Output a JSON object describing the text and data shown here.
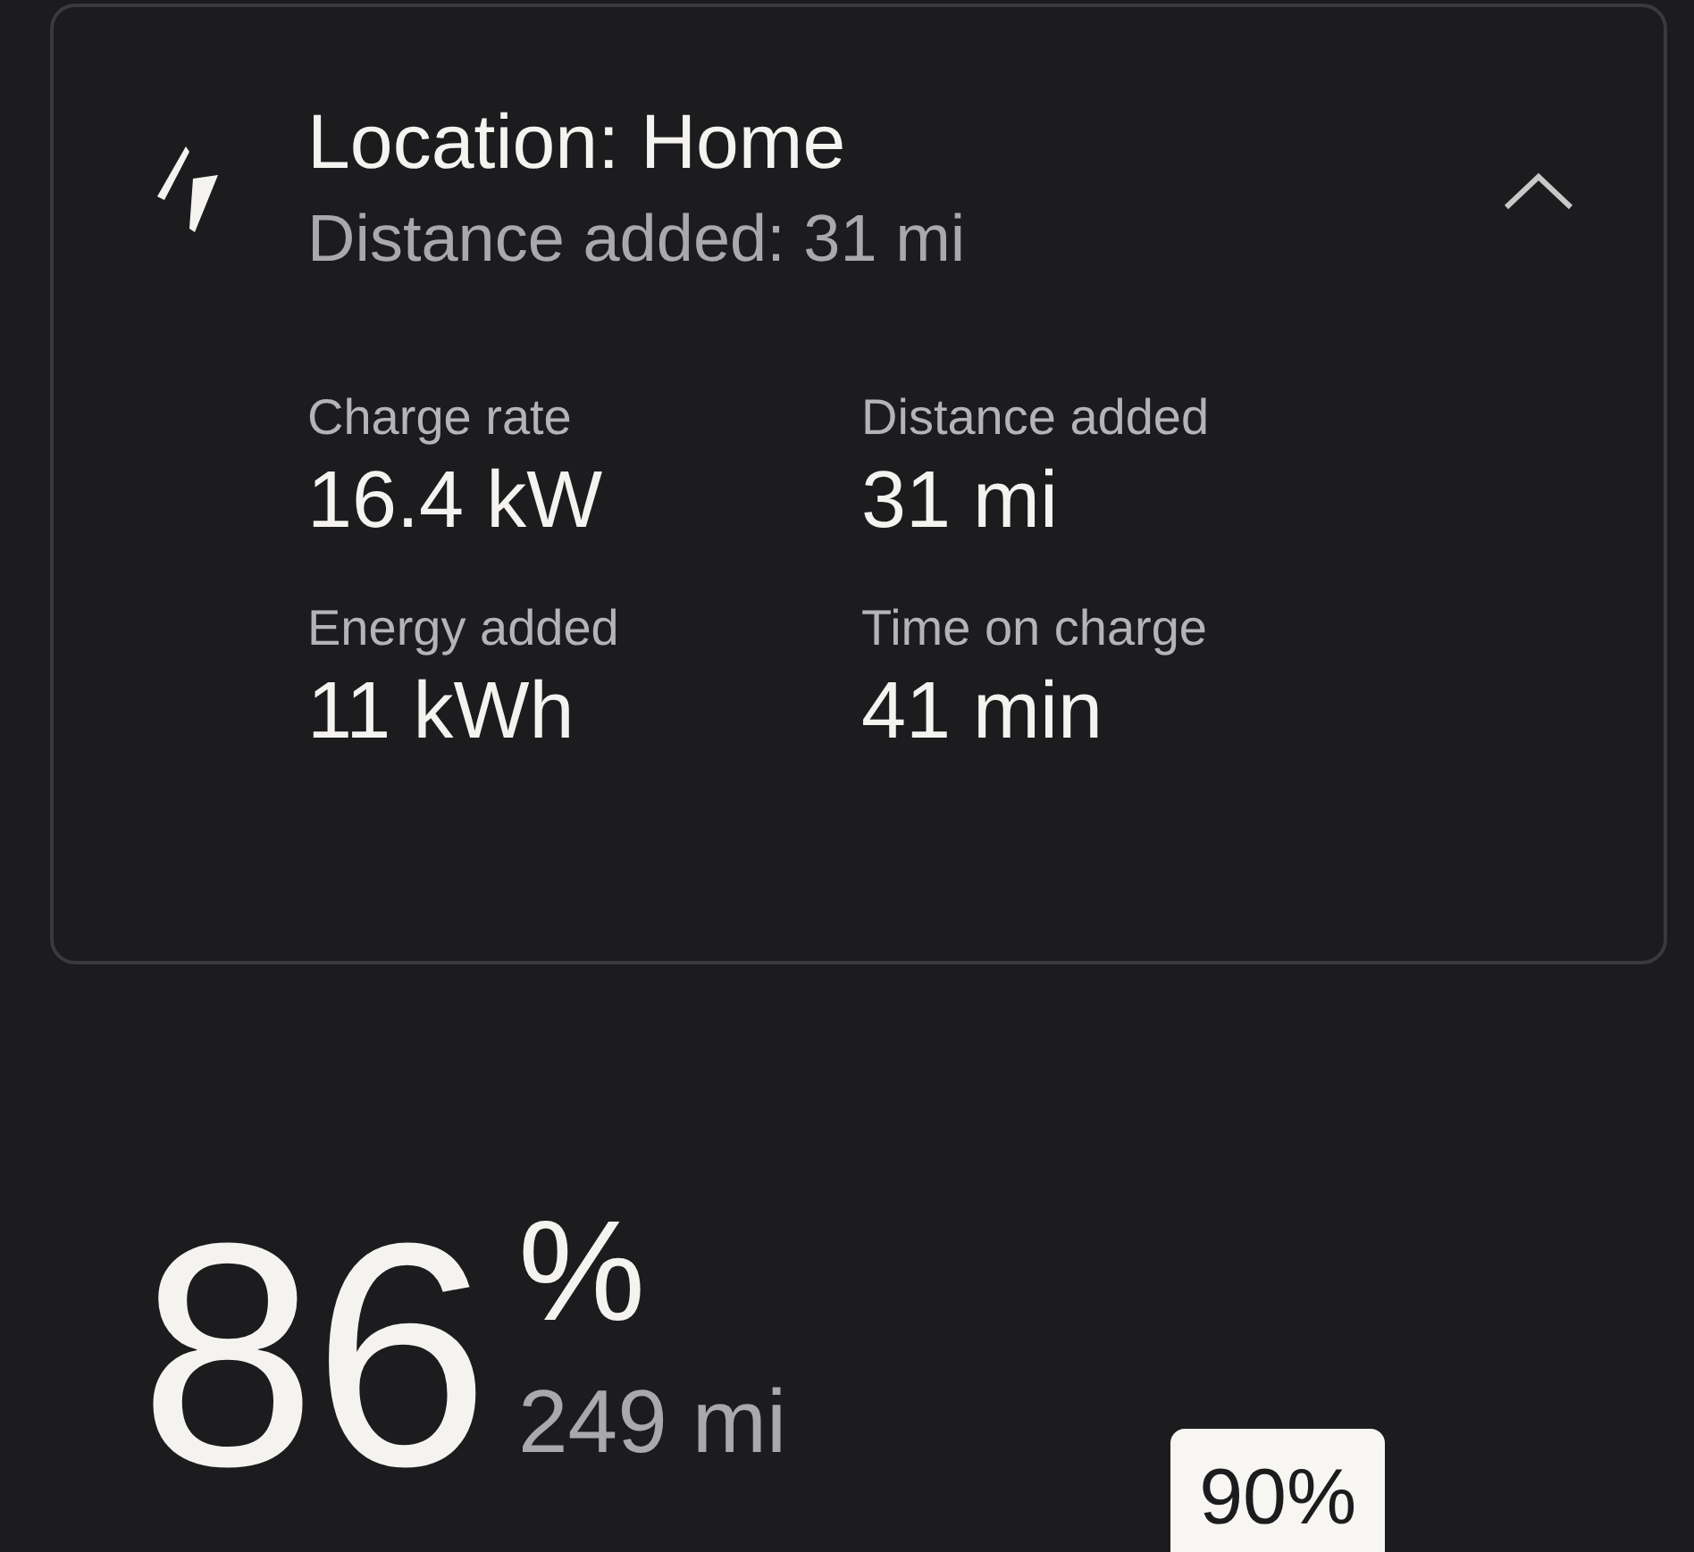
{
  "charge_session": {
    "title": "Location: Home",
    "subtitle": "Distance added: 31 mi",
    "expanded": true,
    "stats": [
      {
        "label": "Charge rate",
        "value": "16.4 kW"
      },
      {
        "label": "Distance added",
        "value": "31 mi"
      },
      {
        "label": "Energy added",
        "value": "11 kWh"
      },
      {
        "label": "Time on charge",
        "value": "41 min"
      }
    ]
  },
  "battery": {
    "percent": "86",
    "unit": "%",
    "range": "249 mi",
    "limit_badge": "90%"
  }
}
